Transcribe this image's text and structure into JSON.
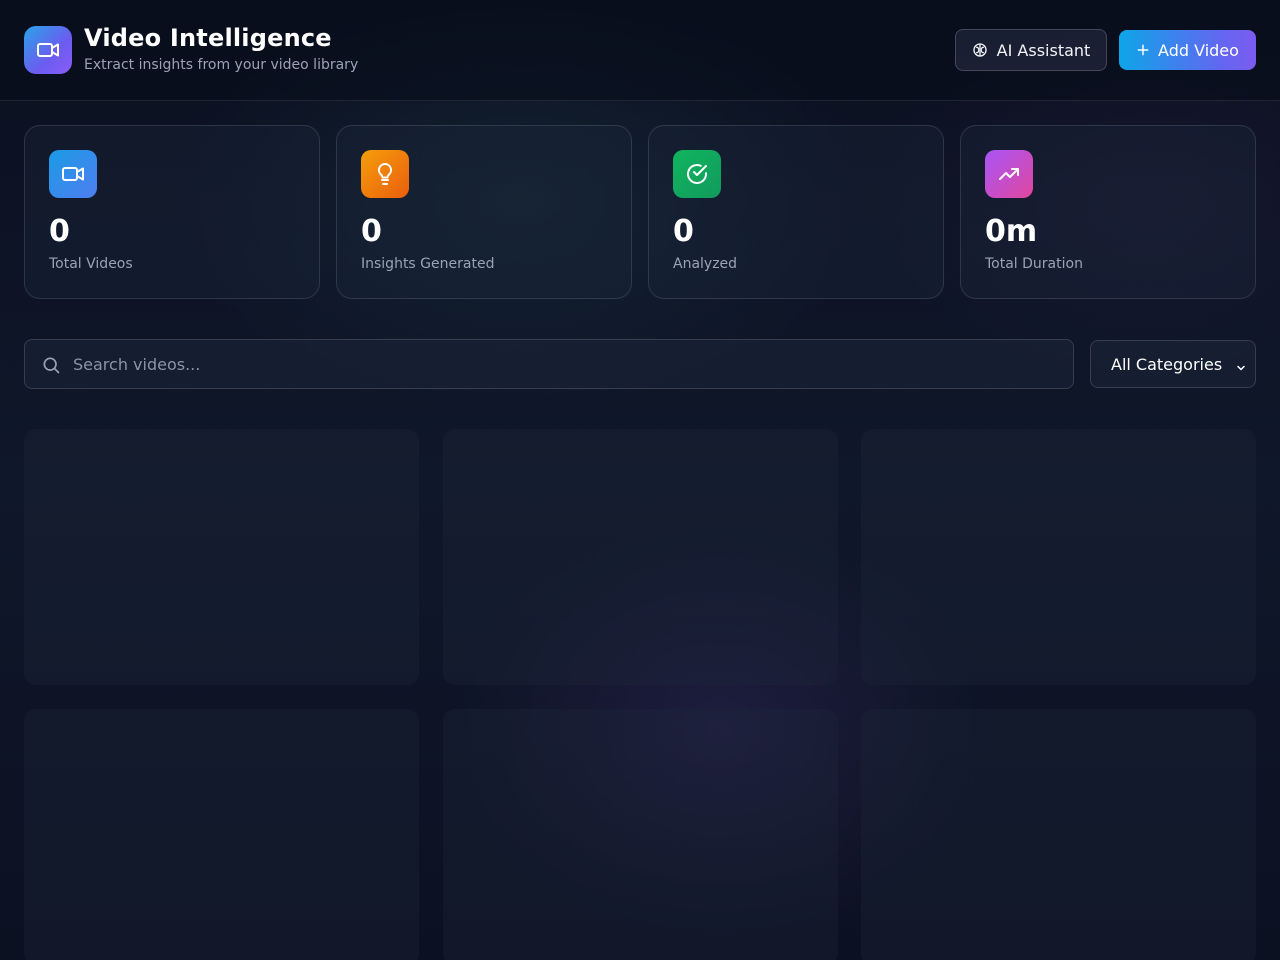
{
  "header": {
    "title": "Video Intelligence",
    "subtitle": "Extract insights from your video library",
    "ai_button_label": "AI Assistant",
    "add_button_label": "Add Video"
  },
  "stats": [
    {
      "value": "0",
      "label": "Total Videos",
      "icon": "video-camera-icon",
      "color": "#2ea1e8"
    },
    {
      "value": "0",
      "label": "Insights Generated",
      "icon": "lightbulb-icon",
      "color": "#f08a12"
    },
    {
      "value": "0",
      "label": "Analyzed",
      "icon": "check-circle-icon",
      "color": "#16a35f"
    },
    {
      "value": "0m",
      "label": "Total Duration",
      "icon": "trending-up-icon",
      "color": "#c44fd8"
    }
  ],
  "search": {
    "placeholder": "Search videos...",
    "value": ""
  },
  "filter": {
    "selected": "All Categories"
  },
  "colors": {
    "background": "#0f172a",
    "accent_start": "#0ea5e9",
    "accent_end": "#7c5cf0"
  }
}
